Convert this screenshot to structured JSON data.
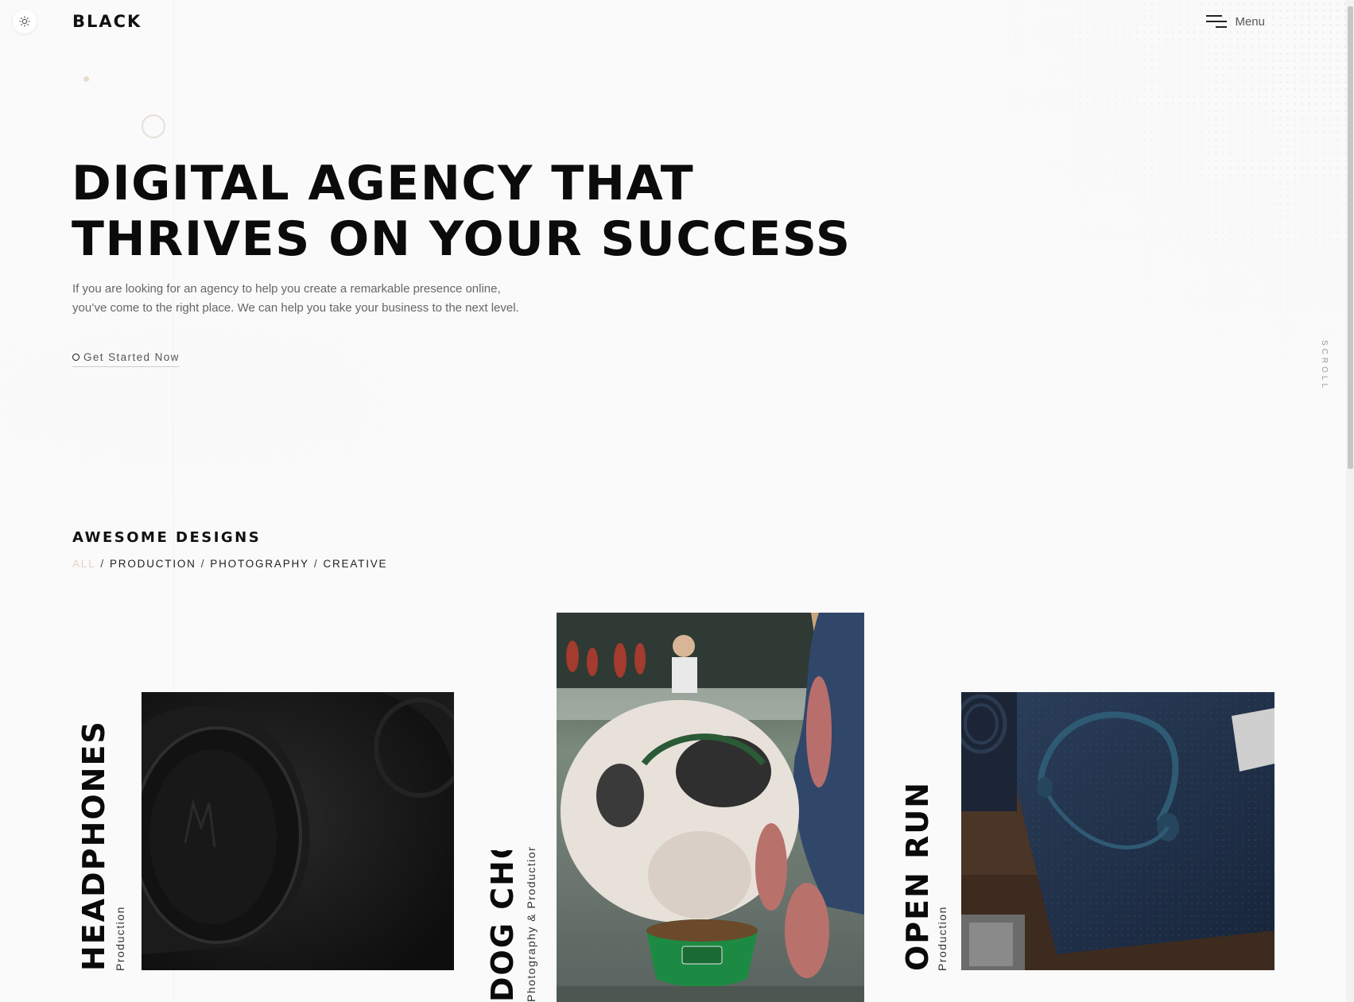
{
  "brand": {
    "logo_text": "BLACK"
  },
  "header": {
    "menu_label": "Menu"
  },
  "hero": {
    "title_line1": "DIGITAL AGENCY THAT",
    "title_line2": "THRIVES ON YOUR SUCCESS",
    "description": "If you are looking for an agency to help you create a remarkable presence online, you’ve come to the right place. We can help you take your business to the next level.",
    "cta_label": "Get Started Now"
  },
  "scroll_label": "SCROLL",
  "portfolio": {
    "section_title": "AWESOME DESIGNS",
    "filters": [
      "ALL",
      "PRODUCTION",
      "PHOTOGRAPHY",
      "CREATIVE"
    ],
    "active_filter": "ALL",
    "projects": [
      {
        "title": "HEADPHONES",
        "category": "Production"
      },
      {
        "title": "DOG CHOW",
        "category": "Photography & Production"
      },
      {
        "title": "OPEN RUN",
        "category": "Production"
      }
    ]
  },
  "colors": {
    "accent": "#dfd2c1",
    "text": "#0b0b0b",
    "muted": "#666666",
    "background": "#fafafa"
  }
}
